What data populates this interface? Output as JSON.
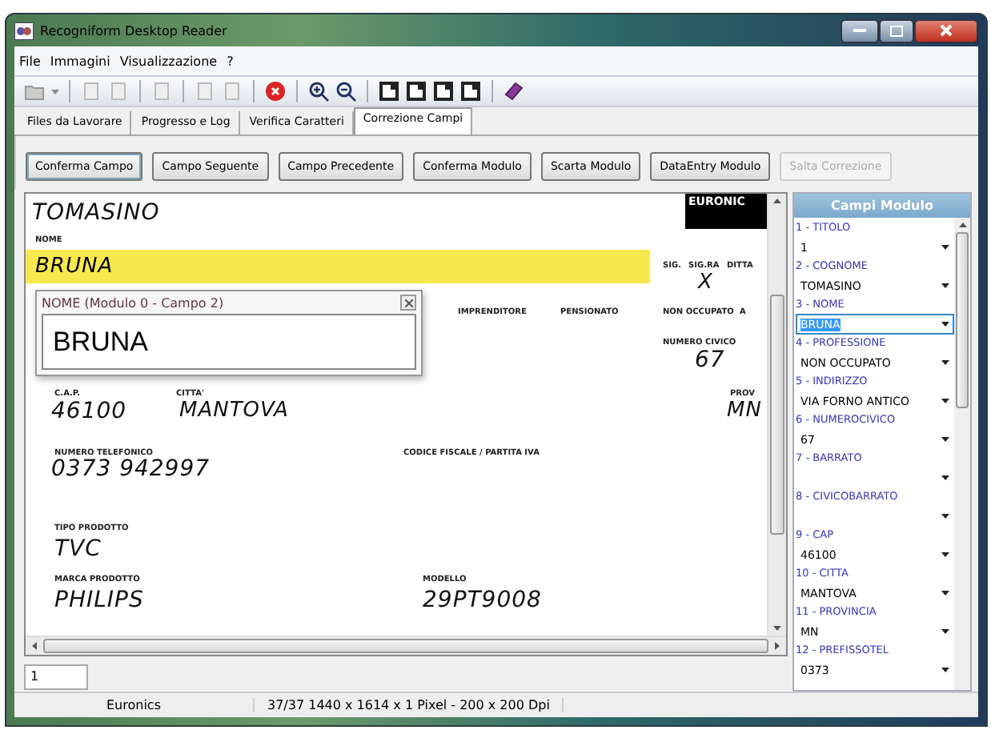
{
  "window": {
    "title": "Recogniform Desktop Reader"
  },
  "menu": [
    "File",
    "Immagini",
    "Visualizzazione",
    "?"
  ],
  "tabs": [
    {
      "label": "Files da Lavorare",
      "selected": false
    },
    {
      "label": "Progresso e Log",
      "selected": false
    },
    {
      "label": "Verifica Caratteri",
      "selected": false
    },
    {
      "label": "Correzione Campi",
      "selected": true
    }
  ],
  "buttons": [
    {
      "label": "Conferma Campo",
      "disabled": false
    },
    {
      "label": "Campo Seguente",
      "disabled": false
    },
    {
      "label": "Campo Precedente",
      "disabled": false
    },
    {
      "label": "Conferma Modulo",
      "disabled": false
    },
    {
      "label": "Scarta Modulo",
      "disabled": false
    },
    {
      "label": "DataEntry Modulo",
      "disabled": false
    },
    {
      "label": "Salta Correzione",
      "disabled": true
    }
  ],
  "document": {
    "logo": "EURONIC",
    "items": [
      {
        "kind": "hand",
        "text": "TOMASINO"
      },
      {
        "kind": "label",
        "text": "NOME"
      },
      {
        "kind": "highlight",
        "text": "BRUNA"
      },
      {
        "kind": "label",
        "text": "SIG."
      },
      {
        "kind": "label",
        "text": "SIG.RA"
      },
      {
        "kind": "label",
        "text": "DITTA"
      },
      {
        "kind": "hand",
        "text": "X"
      },
      {
        "kind": "label",
        "text": "IMPRENDITORE"
      },
      {
        "kind": "label",
        "text": "PENSIONATO"
      },
      {
        "kind": "label",
        "text": "NON OCCUPATO"
      },
      {
        "kind": "label",
        "text": "A"
      },
      {
        "kind": "label",
        "text": "NUMERO CIVICO"
      },
      {
        "kind": "hand",
        "text": "67"
      },
      {
        "kind": "label",
        "text": "C.A.P."
      },
      {
        "kind": "label",
        "text": "CITTA'"
      },
      {
        "kind": "label",
        "text": "PROV"
      },
      {
        "kind": "hand",
        "text": "46100"
      },
      {
        "kind": "hand",
        "text": "MANTOVA"
      },
      {
        "kind": "hand",
        "text": "MN"
      },
      {
        "kind": "label",
        "text": "NUMERO TELEFONICO"
      },
      {
        "kind": "label",
        "text": "CODICE FISCALE / PARTITA IVA"
      },
      {
        "kind": "hand",
        "text": "0373  942997"
      },
      {
        "kind": "label",
        "text": "TIPO PRODOTTO"
      },
      {
        "kind": "hand",
        "text": "TVC"
      },
      {
        "kind": "label",
        "text": "MARCA PRODOTTO"
      },
      {
        "kind": "label",
        "text": "MODELLO"
      },
      {
        "kind": "hand",
        "text": "PHILIPS"
      },
      {
        "kind": "hand",
        "text": "29PT9008"
      }
    ],
    "popup": {
      "title": "NOME (Modulo 0 - Campo 2)",
      "value": "BRUNA"
    }
  },
  "panel": {
    "title": "Campi Modulo",
    "fields": [
      {
        "label": "1 - TITOLO",
        "value": "1",
        "selected": false
      },
      {
        "label": "2 - COGNOME",
        "value": "TOMASINO",
        "selected": false
      },
      {
        "label": "3 - NOME",
        "value": "BRUNA",
        "selected": true
      },
      {
        "label": "4 - PROFESSIONE",
        "value": "NON OCCUPATO",
        "selected": false
      },
      {
        "label": "5 - INDIRIZZO",
        "value": "VIA FORNO ANTICO",
        "selected": false
      },
      {
        "label": "6 - NUMEROCIVICO",
        "value": "67",
        "selected": false
      },
      {
        "label": "7 - BARRATO",
        "selected": false
      },
      {
        "label": "8 - CIVICOBARRATO",
        "selected": false
      },
      {
        "label": "9 - CAP",
        "value": "46100",
        "selected": false
      },
      {
        "label": "10 - CITTA",
        "value": "MANTOVA",
        "selected": false
      },
      {
        "label": "11 - PROVINCIA",
        "value": "MN",
        "selected": false
      },
      {
        "label": "12 - PREFISSOTEL",
        "value": "0373",
        "selected": false
      }
    ]
  },
  "page_field": {
    "value": "1"
  },
  "status_bar": [
    "Euronics",
    "37/37 1440 x 1614 x 1 Pixel - 200 x 200 Dpi"
  ]
}
